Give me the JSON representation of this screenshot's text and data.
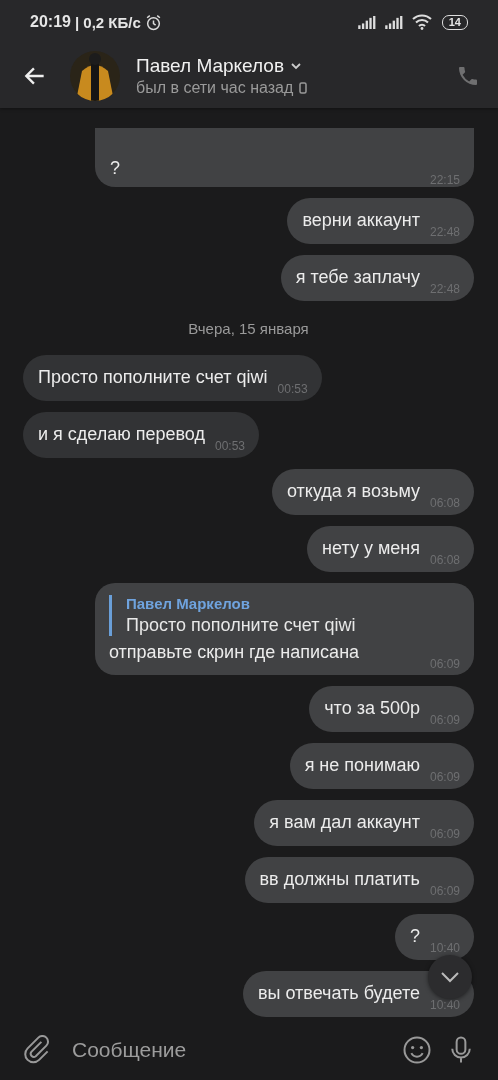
{
  "status_bar": {
    "time": "20:19",
    "network": "| 0,2 КБ/с",
    "battery": "14"
  },
  "header": {
    "name": "Павел Маркелов",
    "status": "был в сети час назад"
  },
  "messages": [
    {
      "kind": "message",
      "outgoing": true,
      "wide": true,
      "text": "?",
      "time": "22:15"
    },
    {
      "kind": "message",
      "outgoing": true,
      "text": "верни аккаунт",
      "time": "22:48"
    },
    {
      "kind": "message",
      "outgoing": true,
      "text": "я тебе заплачу",
      "time": "22:48"
    },
    {
      "kind": "date",
      "text": "Вчера, 15 января"
    },
    {
      "kind": "message",
      "outgoing": false,
      "text": "Просто пополните счет qiwi",
      "time": "00:53"
    },
    {
      "kind": "message",
      "outgoing": false,
      "text": "и я сделаю перевод",
      "time": "00:53"
    },
    {
      "kind": "message",
      "outgoing": true,
      "text": "откуда я возьму",
      "time": "06:08"
    },
    {
      "kind": "message",
      "outgoing": true,
      "text": "нету у меня",
      "time": "06:08"
    },
    {
      "kind": "message",
      "outgoing": true,
      "reply": {
        "author": "Павел Маркелов",
        "text": "Просто пополните счет qiwi"
      },
      "text": "отправьте скрин где написана",
      "time": "06:09"
    },
    {
      "kind": "message",
      "outgoing": true,
      "text": "что за 500р",
      "time": "06:09"
    },
    {
      "kind": "message",
      "outgoing": true,
      "text": "я не понимаю",
      "time": "06:09"
    },
    {
      "kind": "message",
      "outgoing": true,
      "text": "я вам дал аккаунт",
      "time": "06:09"
    },
    {
      "kind": "message",
      "outgoing": true,
      "text": "вв должны платить",
      "time": "06:09"
    },
    {
      "kind": "message",
      "outgoing": true,
      "text": "?",
      "time": "10:40"
    },
    {
      "kind": "message",
      "outgoing": true,
      "text": "вы отвечать будете",
      "time": "10:40"
    }
  ],
  "composer": {
    "placeholder": "Сообщение"
  }
}
